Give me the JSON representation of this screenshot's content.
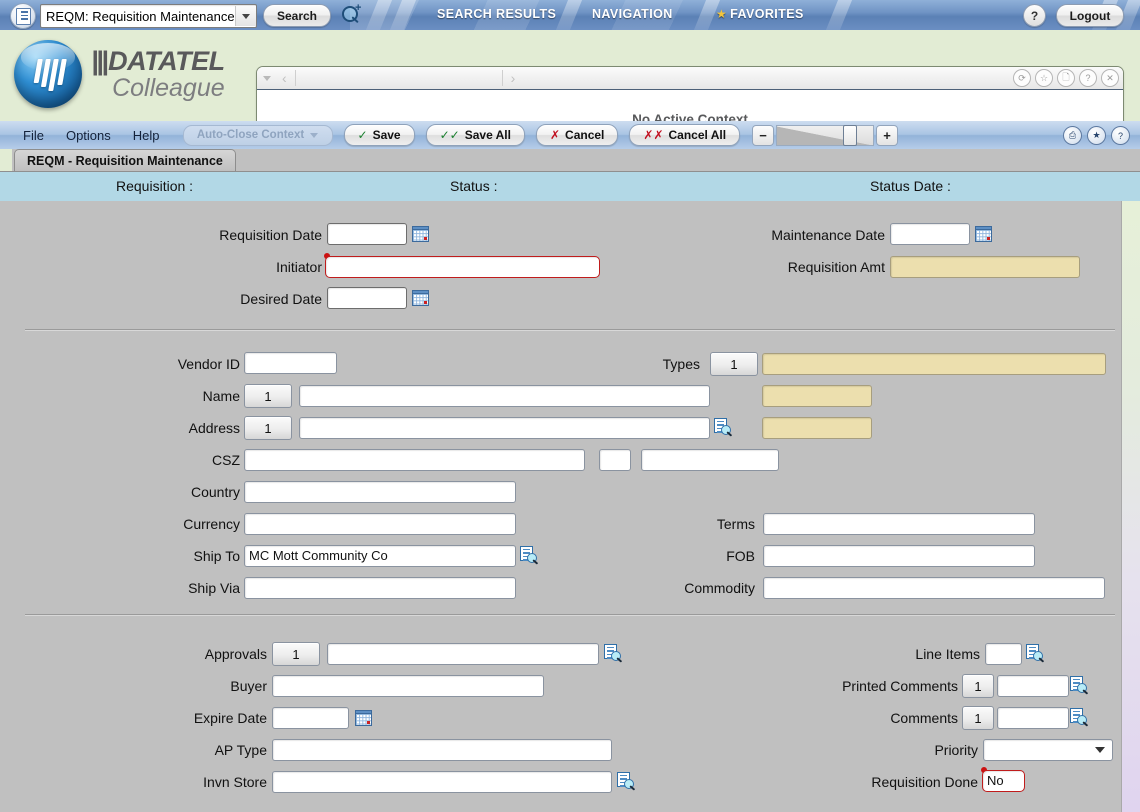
{
  "topbar": {
    "context_icon": "document-list-icon",
    "context_value": "REQM: Requisition Maintenance",
    "search_button": "Search",
    "magnifier_icon": "search-zoom-icon",
    "nav": [
      {
        "label": "SEARCH RESULTS",
        "icon": null
      },
      {
        "label": "NAVIGATION",
        "icon": null
      },
      {
        "label": "FAVORITES",
        "icon": "star-icon"
      }
    ],
    "help_label": "?",
    "logout_label": "Logout"
  },
  "brand": {
    "name": "DATATEL",
    "product": "Colleague"
  },
  "context_panel": {
    "message": "No Active Context",
    "toolbar_icons": [
      "refresh-icon",
      "favorite-star-icon",
      "copy-icon",
      "help-icon",
      "close-icon"
    ],
    "nav_prev": "‹",
    "nav_next": "›"
  },
  "menubar": {
    "items": [
      "File",
      "Options",
      "Help"
    ],
    "auto_close_label": "Auto-Close Context",
    "buttons": [
      {
        "label": "Save",
        "mark": "✓"
      },
      {
        "label": "Save All",
        "mark": "✓✓"
      },
      {
        "label": "Cancel",
        "mark": "✗"
      },
      {
        "label": "Cancel All",
        "mark": "✗✗"
      }
    ],
    "zoom_minus": "−",
    "zoom_plus": "+",
    "right_icons": [
      "print-icon",
      "favorite-star-icon",
      "help-icon"
    ]
  },
  "form_tab": {
    "label": "REQM - Requisition Maintenance"
  },
  "status_row": {
    "requisition": "Requisition :",
    "status": "Status :",
    "status_date": "Status Date :"
  },
  "section1": {
    "requisition_date": {
      "label": "Requisition Date",
      "value": "",
      "icon": "calendar-icon"
    },
    "initiator": {
      "label": "Initiator",
      "value": "",
      "required": true
    },
    "desired_date": {
      "label": "Desired Date",
      "value": "",
      "icon": "calendar-icon"
    },
    "maintenance_date": {
      "label": "Maintenance Date",
      "value": "",
      "icon": "calendar-icon"
    },
    "requisition_amt": {
      "label": "Requisition Amt",
      "value": "",
      "readonly": true
    }
  },
  "section2": {
    "vendor_id": {
      "label": "Vendor ID",
      "value": ""
    },
    "types": {
      "label": "Types",
      "counter": "1",
      "value": ""
    },
    "name": {
      "label": "Name",
      "counter": "1",
      "value": "",
      "value2": ""
    },
    "address": {
      "label": "Address",
      "counter": "1",
      "value": "",
      "value2": "",
      "icon": "detail-lookup-icon"
    },
    "csz": {
      "label": "CSZ",
      "city": "",
      "state": "",
      "zip": ""
    },
    "country": {
      "label": "Country",
      "value": ""
    },
    "currency": {
      "label": "Currency",
      "value": ""
    },
    "ship_to": {
      "label": "Ship To",
      "value": "MC Mott Community Co",
      "icon": "detail-lookup-icon"
    },
    "ship_via": {
      "label": "Ship Via",
      "value": ""
    },
    "terms": {
      "label": "Terms",
      "value": ""
    },
    "fob": {
      "label": "FOB",
      "value": ""
    },
    "commodity": {
      "label": "Commodity",
      "value": ""
    }
  },
  "section3": {
    "approvals": {
      "label": "Approvals",
      "counter": "1",
      "value": "",
      "icon": "detail-lookup-icon"
    },
    "buyer": {
      "label": "Buyer",
      "value": ""
    },
    "expire_date": {
      "label": "Expire Date",
      "value": "",
      "icon": "calendar-icon"
    },
    "ap_type": {
      "label": "AP Type",
      "value": ""
    },
    "invn_store": {
      "label": "Invn Store",
      "value": "",
      "icon": "detail-lookup-icon"
    },
    "line_items": {
      "label": "Line Items",
      "value": "",
      "icon": "detail-lookup-icon"
    },
    "printed_comments": {
      "label": "Printed Comments",
      "counter": "1",
      "value": "",
      "icon": "detail-lookup-icon"
    },
    "comments": {
      "label": "Comments",
      "counter": "1",
      "value": "",
      "icon": "detail-lookup-icon"
    },
    "priority": {
      "label": "Priority",
      "value": ""
    },
    "requisition_done": {
      "label": "Requisition Done",
      "value": "No",
      "required": true
    }
  },
  "colors": {
    "topbar_blue": "#6f93c4",
    "band_green": "#e2ecd4",
    "status_blue": "#b2d8e6",
    "form_gray": "#c0c0c0",
    "readonly_tan": "#ecdfae",
    "required_red": "#c01c1c"
  }
}
